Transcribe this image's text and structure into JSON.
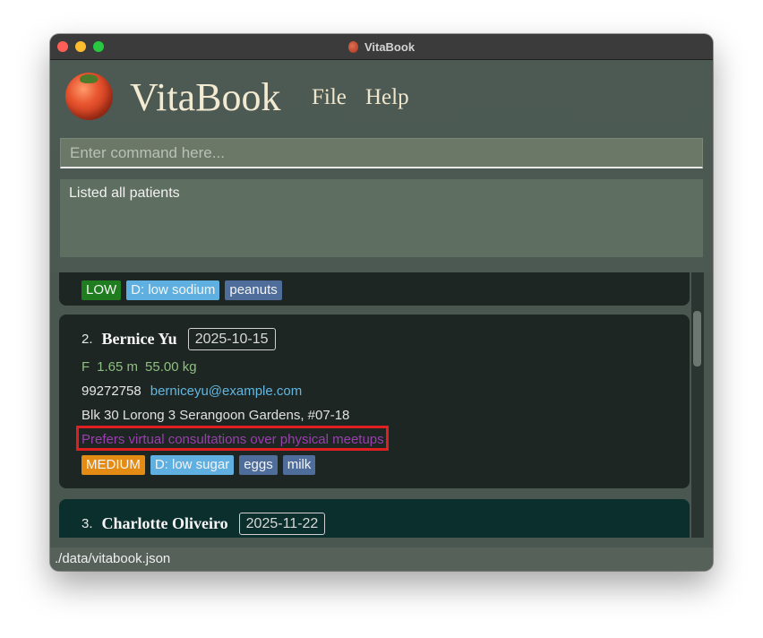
{
  "window": {
    "title": "VitaBook"
  },
  "header": {
    "app_name": "VitaBook",
    "menu": [
      {
        "label": "File"
      },
      {
        "label": "Help"
      }
    ]
  },
  "command": {
    "placeholder": "Enter command here...",
    "value": ""
  },
  "result": {
    "message": "Listed all patients"
  },
  "patients": [
    {
      "tags": {
        "priority": "LOW",
        "diet": "D: low sodium",
        "allergies": [
          "peanuts"
        ]
      }
    },
    {
      "index": "2.",
      "name": "Bernice Yu",
      "date": "2025-10-15",
      "gender": "F",
      "height": "1.65 m",
      "weight": "55.00 kg",
      "phone": "99272758",
      "email": "berniceyu@example.com",
      "address": "Blk 30 Lorong 3 Serangoon Gardens, #07-18",
      "note": "Prefers virtual consultations over physical meetups",
      "tags": {
        "priority": "MEDIUM",
        "diet": "D: low sugar",
        "allergies": [
          "eggs",
          "milk"
        ]
      }
    },
    {
      "index": "3.",
      "name": "Charlotte Oliveiro",
      "date": "2025-11-22"
    }
  ],
  "status": {
    "file_path": "./data/vitabook.json"
  },
  "colors": {
    "priority_low": "#1f7d1f",
    "priority_medium": "#e38b12",
    "diet_tag": "#5fb0e0",
    "allergy_tag": "#4e6d9b",
    "note_text": "#9a3fae",
    "highlight_border": "#e02020"
  },
  "icons": {
    "app_logo": "tomato-icon"
  }
}
